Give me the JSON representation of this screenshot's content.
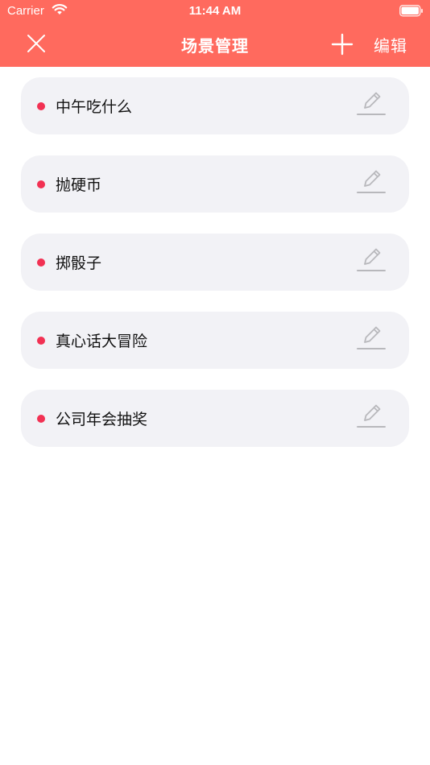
{
  "status_bar": {
    "carrier": "Carrier",
    "time": "11:44 AM"
  },
  "nav": {
    "title": "场景管理",
    "edit_label": "编辑"
  },
  "colors": {
    "header": "#ff6a5e",
    "card": "#f2f2f6",
    "dot": "#f23153",
    "pencil": "#b8b8bc"
  },
  "scenes": [
    {
      "name": "中午吃什么"
    },
    {
      "name": "抛硬币"
    },
    {
      "name": "掷骰子"
    },
    {
      "name": "真心话大冒险"
    },
    {
      "name": "公司年会抽奖"
    }
  ]
}
